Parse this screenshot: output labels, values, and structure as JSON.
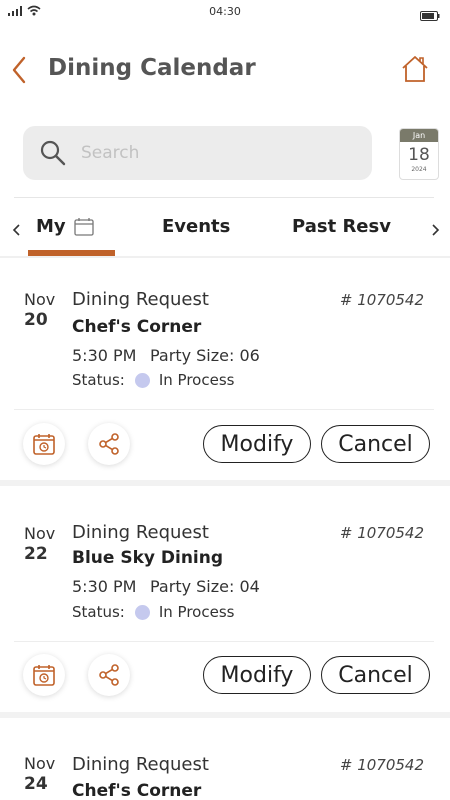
{
  "status_bar": {
    "time": "04:30"
  },
  "header": {
    "title": "Dining Calendar"
  },
  "search": {
    "placeholder": "Search"
  },
  "calendar_widget": {
    "month": "Jan",
    "day": "18",
    "year": "2024"
  },
  "tabs": [
    {
      "label": "My"
    },
    {
      "label": "Events"
    },
    {
      "label": "Past Resv"
    }
  ],
  "reservations": [
    {
      "month": "Nov",
      "day": "20",
      "type": "Dining Request",
      "number": "# 1070542",
      "venue": "Chef's Corner",
      "time": "5:30 PM",
      "party": "Party Size: 06",
      "status_label": "Status:",
      "status": "In Process",
      "modify": "Modify",
      "cancel": "Cancel"
    },
    {
      "month": "Nov",
      "day": "22",
      "type": "Dining Request",
      "number": "# 1070542",
      "venue": "Blue Sky Dining",
      "time": "5:30 PM",
      "party": "Party Size: 04",
      "status_label": "Status:",
      "status": "In Process",
      "modify": "Modify",
      "cancel": "Cancel"
    },
    {
      "month": "Nov",
      "day": "24",
      "type": "Dining Request",
      "number": "# 1070542",
      "venue": "Chef's Corner"
    }
  ],
  "colors": {
    "accent": "#c0622a",
    "status_dot": "#c5c9ee",
    "search_bg": "#ececec"
  }
}
